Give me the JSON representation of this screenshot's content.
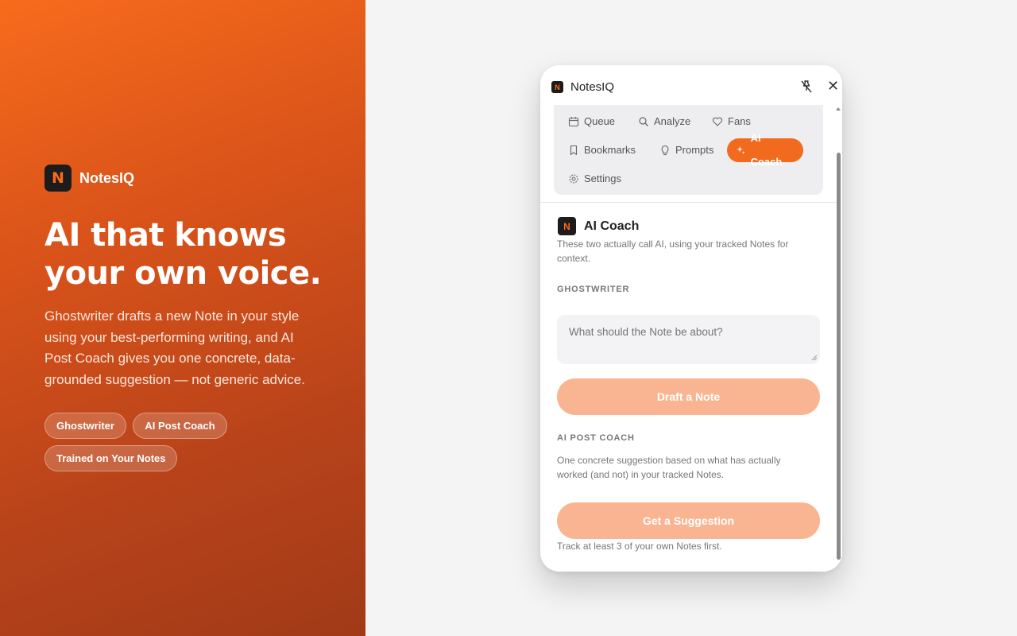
{
  "hero": {
    "brand_logo_letter": "N",
    "brand_name": "NotesIQ",
    "headline": "AI that knows your own voice.",
    "description": "Ghostwriter drafts a new Note in your style using your best-performing writing, and AI Post Coach gives you one concrete, data-grounded suggestion — not generic advice.",
    "chips": [
      "Ghostwriter",
      "AI Post Coach",
      "Trained on Your Notes"
    ],
    "gradient_start": "#f76b1c",
    "gradient_end": "#a13a18"
  },
  "popup": {
    "title": "NotesIQ",
    "logo_letter": "N",
    "pin_icon": "pin-off-icon",
    "close_label": "✕",
    "nav": [
      {
        "label": "Queue",
        "icon": "calendar-icon",
        "active": false
      },
      {
        "label": "Analyze",
        "icon": "search-icon",
        "active": false
      },
      {
        "label": "Fans",
        "icon": "heart-icon",
        "active": false
      },
      {
        "label": "Bookmarks",
        "icon": "bookmark-icon",
        "active": false
      },
      {
        "label": "Prompts",
        "icon": "lightbulb-icon",
        "active": false
      },
      {
        "label": "AI Coach",
        "icon": "sparkle-icon",
        "active": true
      },
      {
        "label": "Settings",
        "icon": "gear-icon",
        "active": false
      }
    ],
    "accent": "#f26a1e",
    "coach": {
      "title": "AI Coach",
      "subtitle": "These two actually call AI, using your tracked Notes for context.",
      "ghostwriter_label": "GHOSTWRITER",
      "ghostwriter_placeholder": "What should the Note be about?",
      "draft_button": "Draft a Note",
      "post_coach_label": "AI POST COACH",
      "post_coach_desc": "One concrete suggestion based on what has actually worked (and not) in your tracked Notes.",
      "suggestion_button": "Get a Suggestion",
      "footer_note": "Track at least 3 of your own Notes first."
    }
  }
}
